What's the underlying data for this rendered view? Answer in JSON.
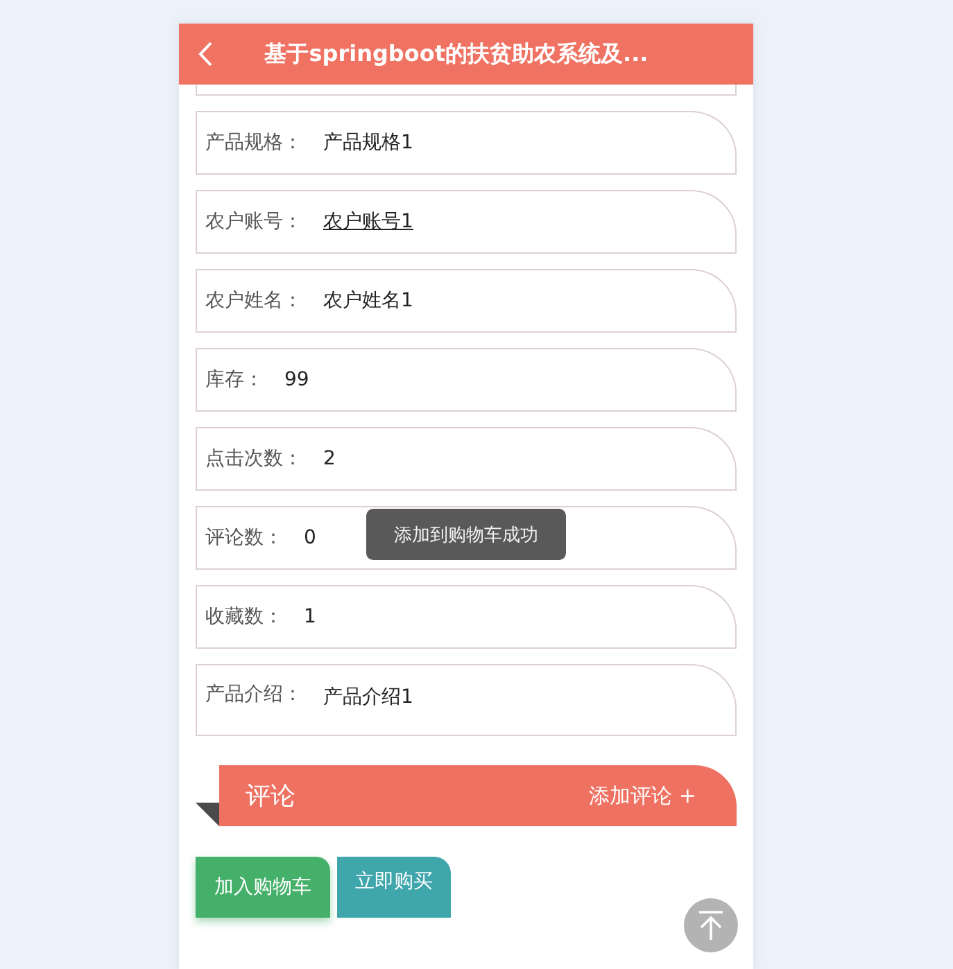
{
  "header": {
    "title": "基于springboot的扶贫助农系统及..."
  },
  "fields": [
    {
      "label": "产品规格：",
      "value": "产品规格1",
      "kind": "text"
    },
    {
      "label": "农户账号：",
      "value": "农户账号1",
      "kind": "link"
    },
    {
      "label": "农户姓名：",
      "value": "农户姓名1",
      "kind": "text"
    },
    {
      "label": "库存：",
      "value": "99",
      "kind": "text"
    },
    {
      "label": "点击次数：",
      "value": "2",
      "kind": "text"
    },
    {
      "label": "评论数：",
      "value": "0",
      "kind": "text"
    },
    {
      "label": "收藏数：",
      "value": "1",
      "kind": "text"
    },
    {
      "label": "产品介绍：",
      "value": "产品介绍1",
      "kind": "textarea"
    }
  ],
  "toast": {
    "text": "添加到购物车成功"
  },
  "comments": {
    "title": "评论",
    "action": "添加评论 +"
  },
  "buttons": [
    {
      "label": "加入购物车",
      "kind": "cart"
    },
    {
      "label": "立即购买",
      "kind": "buy"
    }
  ]
}
